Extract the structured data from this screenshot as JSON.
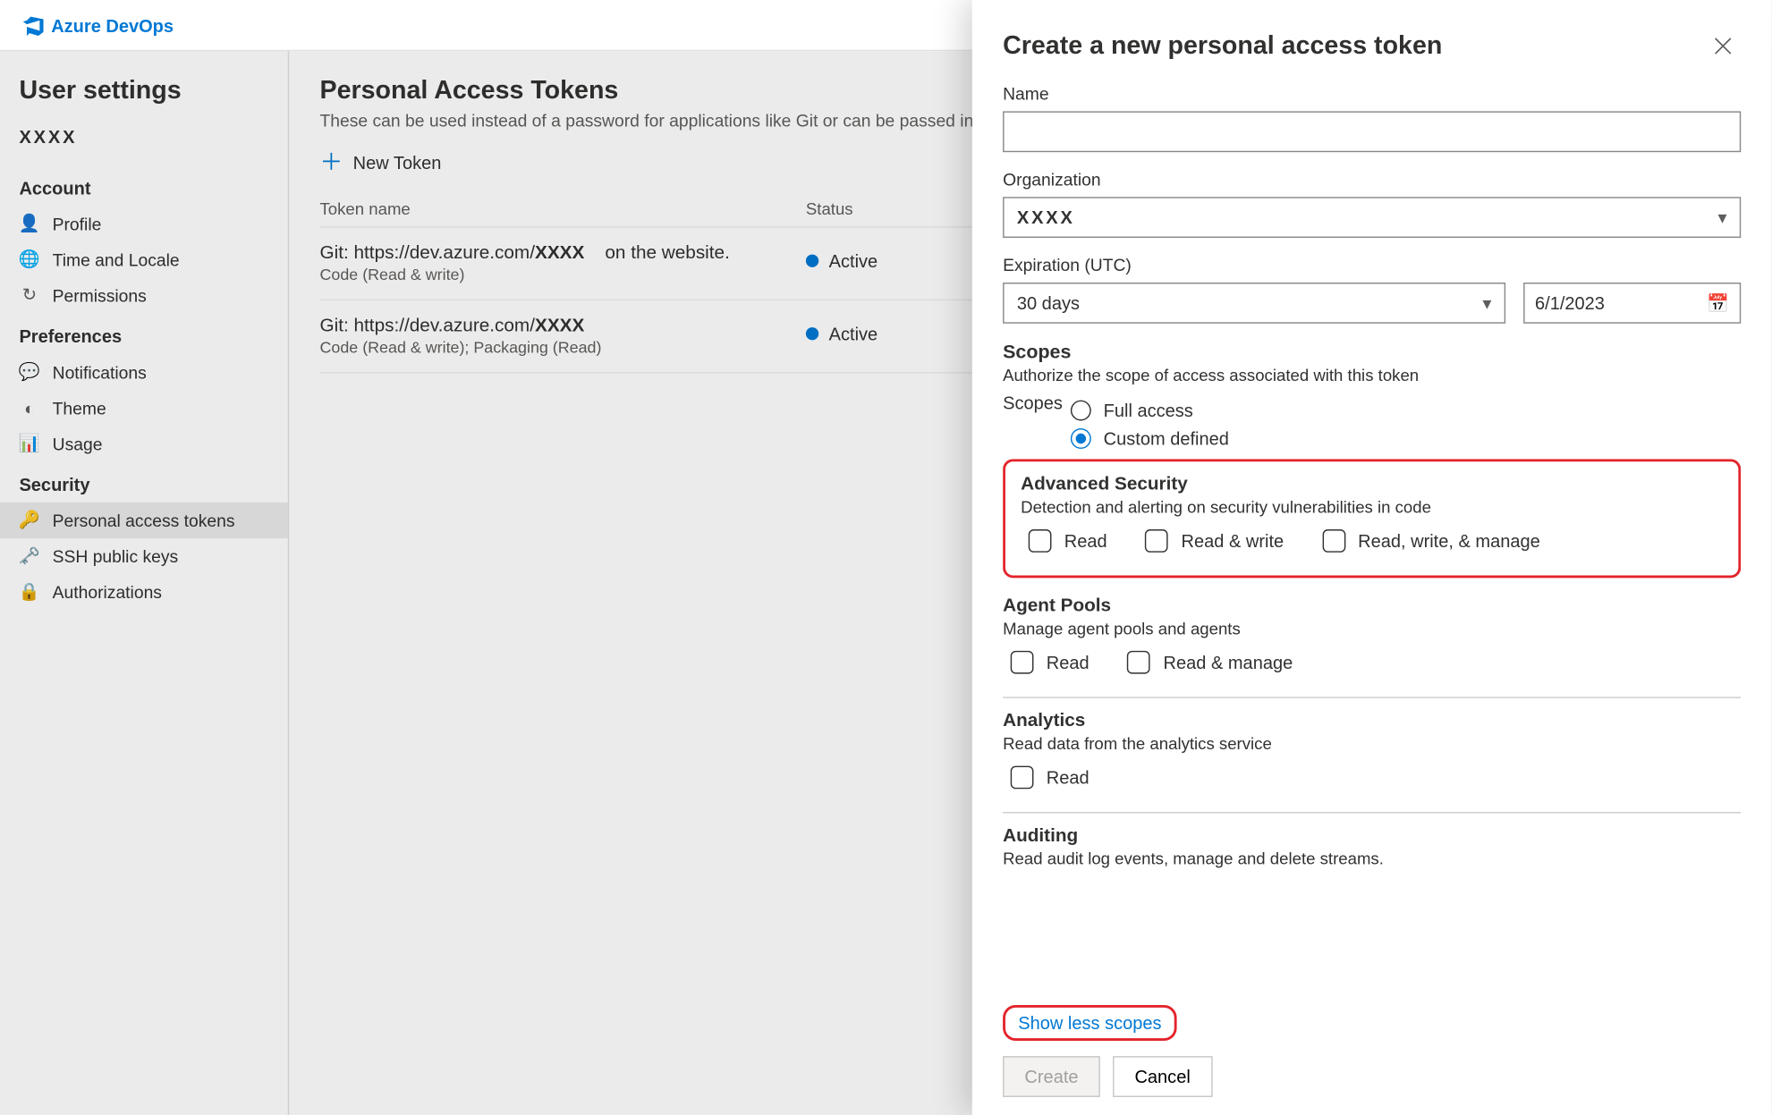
{
  "header": {
    "brand": "Azure DevOps"
  },
  "sidebar": {
    "title": "User settings",
    "user": "XXXX",
    "groups": [
      {
        "label": "Account",
        "items": [
          {
            "label": "Profile",
            "icon": "person-card-icon"
          },
          {
            "label": "Time and Locale",
            "icon": "globe-icon"
          },
          {
            "label": "Permissions",
            "icon": "refresh-icon"
          }
        ]
      },
      {
        "label": "Preferences",
        "items": [
          {
            "label": "Notifications",
            "icon": "chat-icon"
          },
          {
            "label": "Theme",
            "icon": "theme-icon"
          },
          {
            "label": "Usage",
            "icon": "chart-icon"
          }
        ]
      },
      {
        "label": "Security",
        "items": [
          {
            "label": "Personal access tokens",
            "icon": "key-icon",
            "selected": true
          },
          {
            "label": "SSH public keys",
            "icon": "ssh-key-icon"
          },
          {
            "label": "Authorizations",
            "icon": "lock-icon"
          }
        ]
      }
    ]
  },
  "main": {
    "title": "Personal Access Tokens",
    "subtitle": "These can be used instead of a password for applications like Git or can be passed in",
    "new_token": "New Token",
    "columns": {
      "name": "Token name",
      "status": "Status"
    },
    "rows": [
      {
        "name_pre": "Git: https://dev.azure.com/",
        "name_suf": "XXXX",
        "extra": "on the website.",
        "desc": "Code (Read & write)",
        "status": "Active"
      },
      {
        "name_pre": "Git: https://dev.azure.com/",
        "name_suf": "XXXX",
        "extra": "",
        "desc": "Code (Read & write); Packaging (Read)",
        "status": "Active"
      }
    ]
  },
  "panel": {
    "title": "Create a new personal access token",
    "labels": {
      "name": "Name",
      "organization": "Organization",
      "expiration": "Expiration (UTC)",
      "scopes_title": "Scopes",
      "scopes_desc": "Authorize the scope of access associated with this token",
      "scopes_word": "Scopes",
      "full_access": "Full access",
      "custom_defined": "Custom defined",
      "show_less": "Show less scopes",
      "create": "Create",
      "cancel": "Cancel"
    },
    "values": {
      "name": "",
      "organization": "XXXX",
      "expiration_select": "30 days",
      "expiration_date": "6/1/2023",
      "scope_mode": "custom"
    },
    "scope_groups": [
      {
        "title": "Advanced Security",
        "desc": "Detection and alerting on security vulnerabilities in code",
        "highlight": true,
        "options": [
          "Read",
          "Read & write",
          "Read, write, & manage"
        ]
      },
      {
        "title": "Agent Pools",
        "desc": "Manage agent pools and agents",
        "options": [
          "Read",
          "Read & manage"
        ]
      },
      {
        "title": "Analytics",
        "desc": "Read data from the analytics service",
        "options": [
          "Read"
        ]
      },
      {
        "title": "Auditing",
        "desc": "Read audit log events, manage and delete streams.",
        "options": []
      }
    ]
  }
}
